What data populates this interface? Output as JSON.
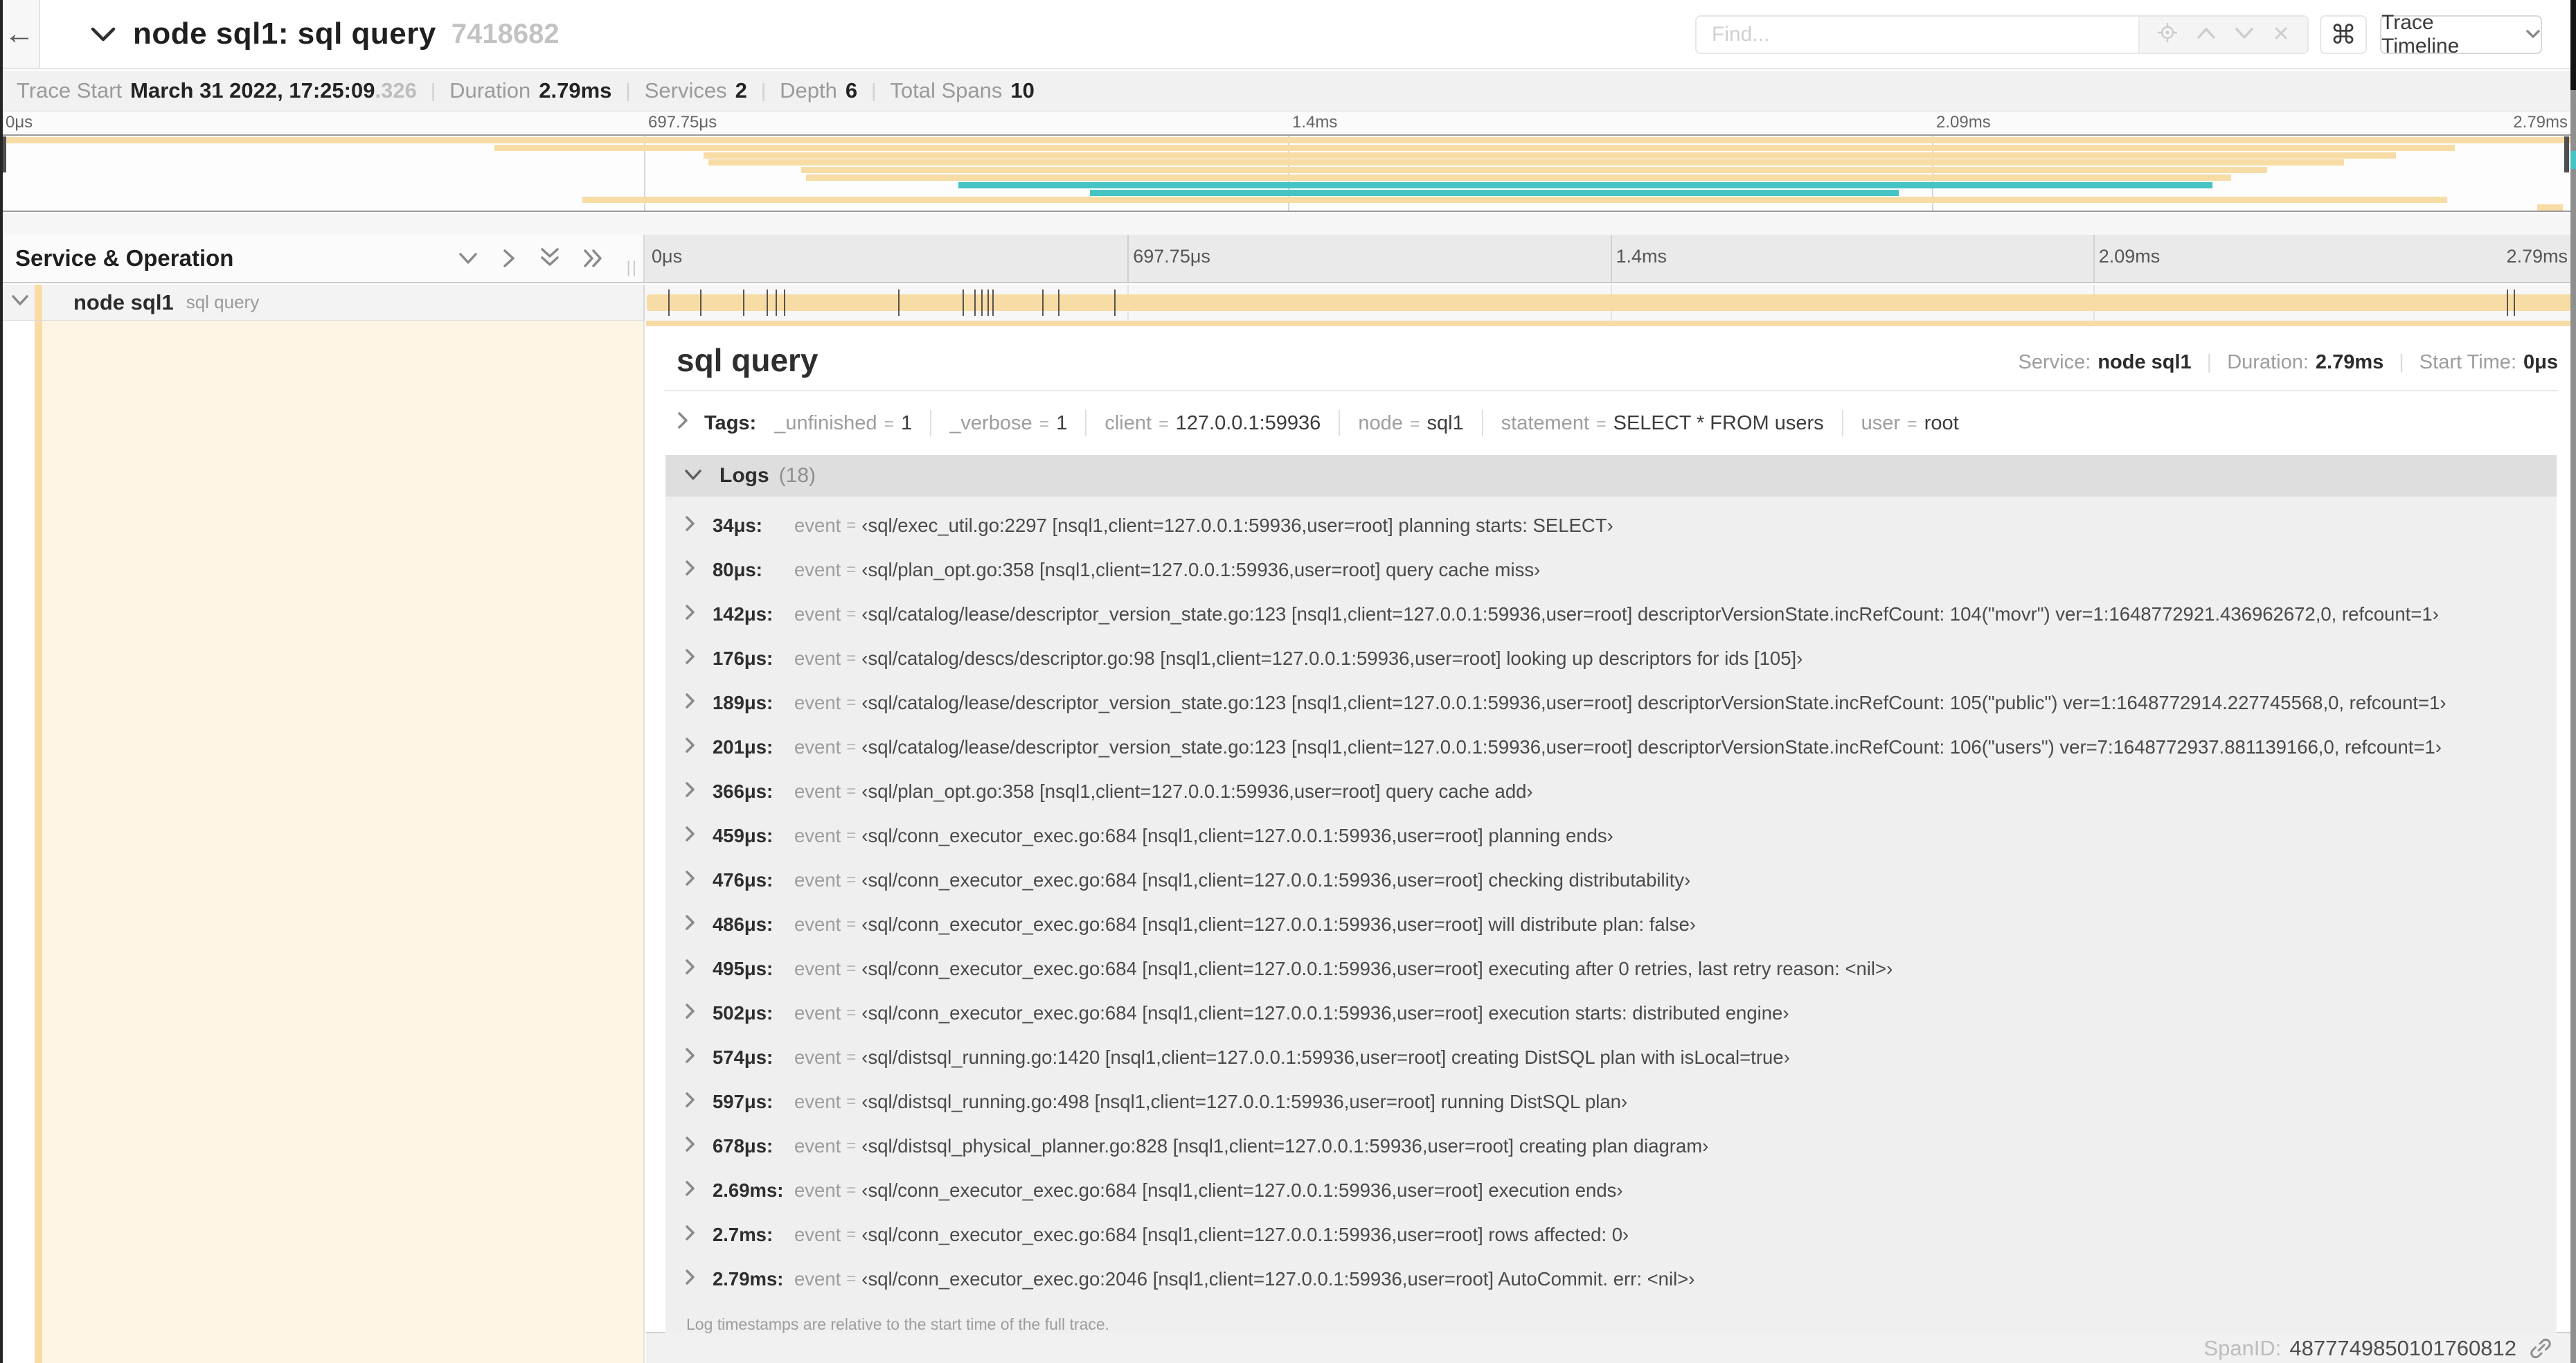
{
  "header": {
    "back_glyph": "←",
    "title": "node sql1: sql query",
    "trace_id": "7418682",
    "find_placeholder": "Find...",
    "clear_glyph": "✕",
    "command_glyph": "⌘",
    "view_selector_label": "Trace Timeline"
  },
  "summary": {
    "trace_start_label": "Trace Start",
    "trace_start": "March 31 2022, 17:25:09",
    "trace_start_frac": ".326",
    "duration_label": "Duration",
    "duration": "2.79ms",
    "services_label": "Services",
    "services": "2",
    "depth_label": "Depth",
    "depth": "6",
    "total_spans_label": "Total Spans",
    "total_spans": "10"
  },
  "minimap": {
    "ticks": [
      "0μs",
      "697.75μs",
      "1.4ms",
      "2.09ms",
      "2.79ms"
    ],
    "rows": [
      {
        "start": 0,
        "end": 100,
        "color": "tan"
      },
      {
        "start": 19.2,
        "end": 95.3,
        "color": "tan"
      },
      {
        "start": 27.3,
        "end": 93.0,
        "color": "tan"
      },
      {
        "start": 27.5,
        "end": 91.0,
        "color": "tan"
      },
      {
        "start": 31.1,
        "end": 88.0,
        "color": "tan"
      },
      {
        "start": 31.3,
        "end": 86.6,
        "color": "tan"
      },
      {
        "start": 37.2,
        "end": 85.9,
        "color": "teal"
      },
      {
        "start": 42.3,
        "end": 73.7,
        "color": "teal"
      },
      {
        "start": 22.6,
        "end": 95.0,
        "color": "tan"
      },
      {
        "start": 98.5,
        "end": 99.5,
        "color": "tan"
      }
    ]
  },
  "timeline": {
    "columns_header": "Service & Operation",
    "ticks": [
      "0μs",
      "697.75μs",
      "1.4ms",
      "2.09ms",
      "2.79ms"
    ],
    "total_us": 2790,
    "row": {
      "service": "node sql1",
      "operation": "sql query"
    }
  },
  "detail": {
    "title": "sql query",
    "service_label": "Service:",
    "service": "node sql1",
    "duration_label": "Duration:",
    "duration": "2.79ms",
    "start_label": "Start Time:",
    "start": "0μs",
    "tags_label": "Tags:",
    "tags": [
      {
        "key": "_unfinished",
        "value": "1"
      },
      {
        "key": "_verbose",
        "value": "1"
      },
      {
        "key": "client",
        "value": "127.0.0.1:59936"
      },
      {
        "key": "node",
        "value": "sql1"
      },
      {
        "key": "statement",
        "value": "SELECT * FROM users"
      },
      {
        "key": "user",
        "value": "root"
      }
    ],
    "logs_label": "Logs",
    "logs_count": "(18)",
    "log_field_key": "event",
    "logs": [
      {
        "t": "34μs:",
        "us": 34,
        "text": "‹sql/exec_util.go:2297 [nsql1,client=127.0.0.1:59936,user=root] planning starts: SELECT›"
      },
      {
        "t": "80μs:",
        "us": 80,
        "text": "‹sql/plan_opt.go:358 [nsql1,client=127.0.0.1:59936,user=root] query cache miss›"
      },
      {
        "t": "142μs:",
        "us": 142,
        "text": "‹sql/catalog/lease/descriptor_version_state.go:123 [nsql1,client=127.0.0.1:59936,user=root] descriptorVersionState.incRefCount: 104(\"movr\") ver=1:1648772921.436962672,0, refcount=1›"
      },
      {
        "t": "176μs:",
        "us": 176,
        "text": "‹sql/catalog/descs/descriptor.go:98 [nsql1,client=127.0.0.1:59936,user=root] looking up descriptors for ids [105]›"
      },
      {
        "t": "189μs:",
        "us": 189,
        "text": "‹sql/catalog/lease/descriptor_version_state.go:123 [nsql1,client=127.0.0.1:59936,user=root] descriptorVersionState.incRefCount: 105(\"public\") ver=1:1648772914.227745568,0, refcount=1›"
      },
      {
        "t": "201μs:",
        "us": 201,
        "text": "‹sql/catalog/lease/descriptor_version_state.go:123 [nsql1,client=127.0.0.1:59936,user=root] descriptorVersionState.incRefCount: 106(\"users\") ver=7:1648772937.881139166,0, refcount=1›"
      },
      {
        "t": "366μs:",
        "us": 366,
        "text": "‹sql/plan_opt.go:358 [nsql1,client=127.0.0.1:59936,user=root] query cache add›"
      },
      {
        "t": "459μs:",
        "us": 459,
        "text": "‹sql/conn_executor_exec.go:684 [nsql1,client=127.0.0.1:59936,user=root] planning ends›"
      },
      {
        "t": "476μs:",
        "us": 476,
        "text": "‹sql/conn_executor_exec.go:684 [nsql1,client=127.0.0.1:59936,user=root] checking distributability›"
      },
      {
        "t": "486μs:",
        "us": 486,
        "text": "‹sql/conn_executor_exec.go:684 [nsql1,client=127.0.0.1:59936,user=root] will distribute plan: false›"
      },
      {
        "t": "495μs:",
        "us": 495,
        "text": "‹sql/conn_executor_exec.go:684 [nsql1,client=127.0.0.1:59936,user=root] executing after 0 retries, last retry reason: <nil>›"
      },
      {
        "t": "502μs:",
        "us": 502,
        "text": "‹sql/conn_executor_exec.go:684 [nsql1,client=127.0.0.1:59936,user=root] execution starts: distributed engine›"
      },
      {
        "t": "574μs:",
        "us": 574,
        "text": "‹sql/distsql_running.go:1420 [nsql1,client=127.0.0.1:59936,user=root] creating DistSQL plan with isLocal=true›"
      },
      {
        "t": "597μs:",
        "us": 597,
        "text": "‹sql/distsql_running.go:498 [nsql1,client=127.0.0.1:59936,user=root] running DistSQL plan›"
      },
      {
        "t": "678μs:",
        "us": 678,
        "text": "‹sql/distsql_physical_planner.go:828 [nsql1,client=127.0.0.1:59936,user=root] creating plan diagram›"
      },
      {
        "t": "2.69ms:",
        "us": 2690,
        "text": "‹sql/conn_executor_exec.go:684 [nsql1,client=127.0.0.1:59936,user=root] execution ends›"
      },
      {
        "t": "2.7ms:",
        "us": 2700,
        "text": "‹sql/conn_executor_exec.go:684 [nsql1,client=127.0.0.1:59936,user=root] rows affected: 0›"
      },
      {
        "t": "2.79ms:",
        "us": 2790,
        "text": "‹sql/conn_executor_exec.go:2046 [nsql1,client=127.0.0.1:59936,user=root] AutoCommit. err: <nil>›"
      }
    ],
    "logs_note": "Log timestamps are relative to the start time of the full trace.",
    "span_id_label": "SpanID:",
    "span_id": "4877749850101760812"
  },
  "colors": {
    "tan": "#f7dca6",
    "teal": "#46c3c3",
    "cream": "#fdf4e3"
  }
}
